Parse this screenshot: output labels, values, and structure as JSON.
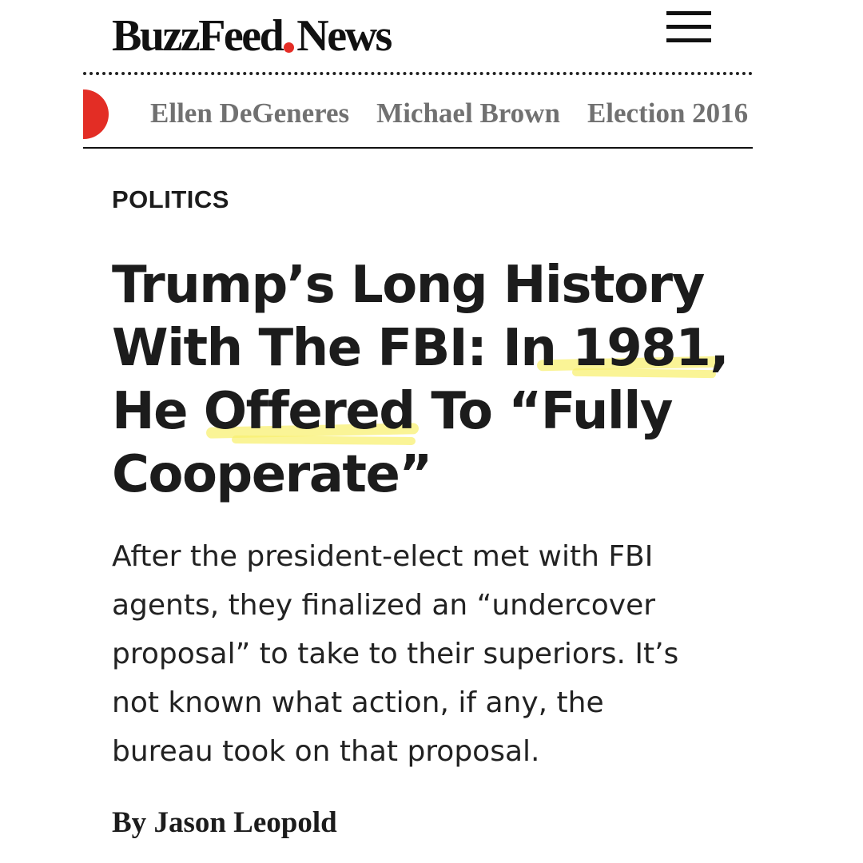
{
  "header": {
    "logo_part1": "BuzzFeed",
    "logo_part2": "News",
    "menu_icon": "hamburger-menu-icon"
  },
  "trending": {
    "badge_color": "#e32d25",
    "items": [
      {
        "label": "Ellen DeGeneres"
      },
      {
        "label": "Michael Brown"
      },
      {
        "label": "Election 2016"
      }
    ]
  },
  "article": {
    "category": "POLITICS",
    "headline_lines": [
      "Trump’s Long History",
      "With The FBI: In 1981,",
      "He Offered To “Fully",
      "Cooperate”"
    ],
    "highlight_color": "#f8f06e",
    "dek_lines": [
      "After the president-elect met with FBI",
      "agents, they finalized an “undercover",
      "proposal” to take to their superiors. It’s",
      "not known what action, if any, the",
      "bureau took on that proposal."
    ],
    "byline_prefix": "By",
    "byline_author": "Jason Leopold"
  },
  "colors": {
    "brand_red": "#e42c25",
    "text": "#1c1c1c",
    "trending_text": "#717171"
  }
}
